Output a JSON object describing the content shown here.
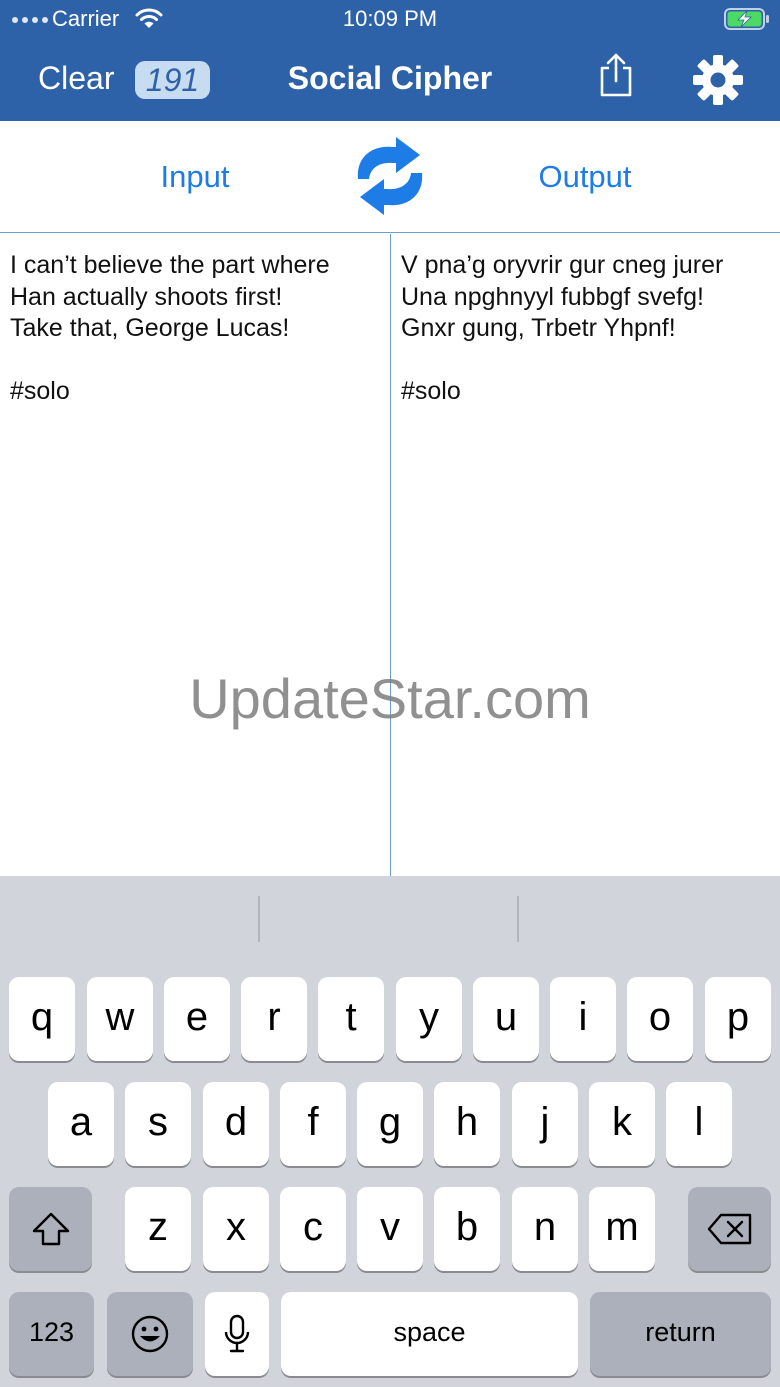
{
  "status_bar": {
    "carrier": "Carrier",
    "time": "10:09 PM"
  },
  "nav": {
    "clear_label": "Clear",
    "count": "191",
    "title": "Social Cipher",
    "share_icon": "share-icon",
    "settings_icon": "gear-icon"
  },
  "tabs": {
    "input_label": "Input",
    "output_label": "Output",
    "swap_icon": "swap-arrows-icon"
  },
  "input_text": "I can’t believe the part where\nHan actually shoots first!\nTake that, George Lucas!\n\n#solo",
  "output_text": "V pna’g oryvrir gur cneg jurer\nUna npghnyyl fubbgf svefg!\nGnxr gung, Trbetr Yhpnf!\n\n#solo",
  "watermark": "UpdateStar.com",
  "keyboard": {
    "row1": [
      "q",
      "w",
      "e",
      "r",
      "t",
      "y",
      "u",
      "i",
      "o",
      "p"
    ],
    "row2": [
      "a",
      "s",
      "d",
      "f",
      "g",
      "h",
      "j",
      "k",
      "l"
    ],
    "row3": [
      "z",
      "x",
      "c",
      "v",
      "b",
      "n",
      "m"
    ],
    "numbers_label": "123",
    "space_label": "space",
    "return_label": "return"
  },
  "colors": {
    "nav_bar": "#2E62A8",
    "accent": "#1E7CE6",
    "badge_bg": "#C8DCF1",
    "divider": "#6C9BD0",
    "keyboard_bg": "#D1D4DA",
    "battery_charge": "#4CD964"
  }
}
